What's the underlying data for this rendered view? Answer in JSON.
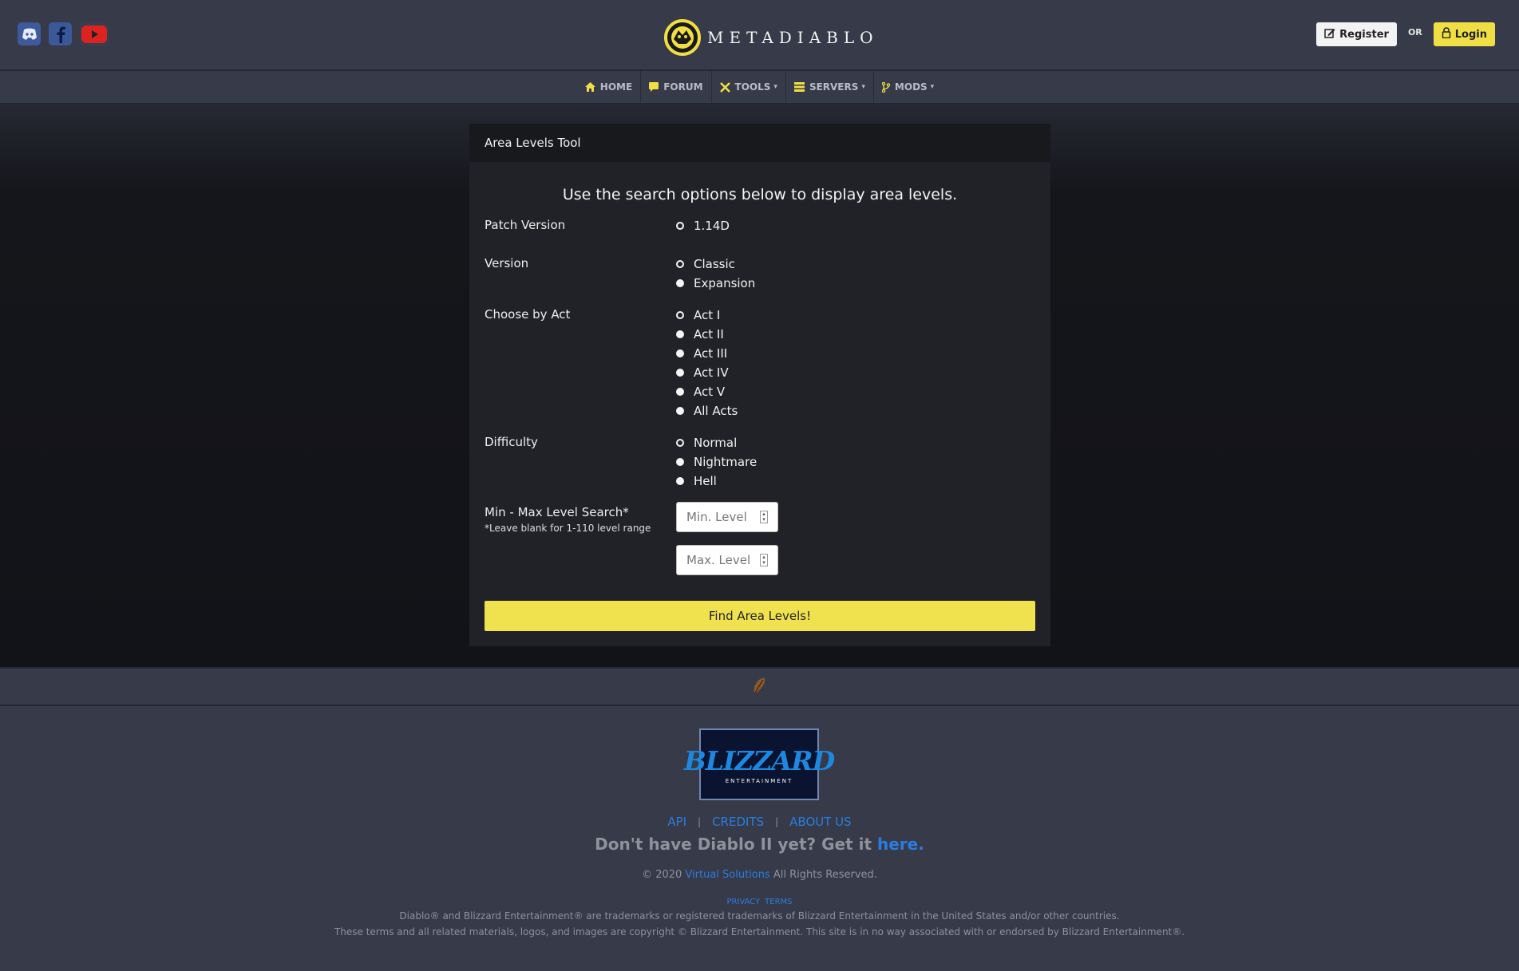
{
  "header": {
    "logo_text": "METADIABLO",
    "register_label": "Register",
    "or_label": "OR",
    "login_label": "Login"
  },
  "nav": {
    "items": [
      {
        "label": "HOME",
        "icon": "home-icon"
      },
      {
        "label": "FORUM",
        "icon": "chat-icon"
      },
      {
        "label": "TOOLS",
        "icon": "tools-icon"
      },
      {
        "label": "SERVERS",
        "icon": "servers-icon"
      },
      {
        "label": "MODS",
        "icon": "branch-icon"
      }
    ]
  },
  "card": {
    "title": "Area Levels Tool",
    "intro": "Use the search options below to display area levels.",
    "patch": {
      "label": "Patch Version",
      "options": [
        "1.14D"
      ]
    },
    "version": {
      "label": "Version",
      "options": [
        "Classic",
        "Expansion"
      ]
    },
    "act": {
      "label": "Choose by Act",
      "options": [
        "Act I",
        "Act II",
        "Act III",
        "Act IV",
        "Act V",
        "All Acts"
      ]
    },
    "difficulty": {
      "label": "Difficulty",
      "options": [
        "Normal",
        "Nightmare",
        "Hell"
      ]
    },
    "level": {
      "label": "Min - Max Level Search*",
      "note": "*Leave blank for 1-110 level range",
      "min_placeholder": "Min. Level",
      "max_placeholder": "Max. Level"
    },
    "submit_label": "Find Area Levels!"
  },
  "footer": {
    "brand_main": "BLIZZARD",
    "brand_sub": "ENTERTAINMENT",
    "links": [
      "API",
      "CREDITS",
      "ABOUT US"
    ],
    "promo_text": "Don't have Diablo II yet? Get it ",
    "promo_link": "here.",
    "copyright_prefix": "© 2020 ",
    "copyright_company": "Virtual Solutions",
    "copyright_suffix": " All Rights Reserved.",
    "policy_links": [
      "PRIVACY",
      "TERMS"
    ],
    "legal_line1": "Diablo® and Blizzard Entertainment® are trademarks or registered trademarks of Blizzard Entertainment in the United States and/or other countries.",
    "legal_line2": "These terms and all related materials, logos, and images are copyright © Blizzard Entertainment. This site is in no way associated with or endorsed by Blizzard Entertainment®."
  },
  "colors": {
    "accent_yellow": "#f0e24e",
    "link_blue": "#2a7de0",
    "header_bg": "#373a48",
    "card_bg": "#212227"
  }
}
